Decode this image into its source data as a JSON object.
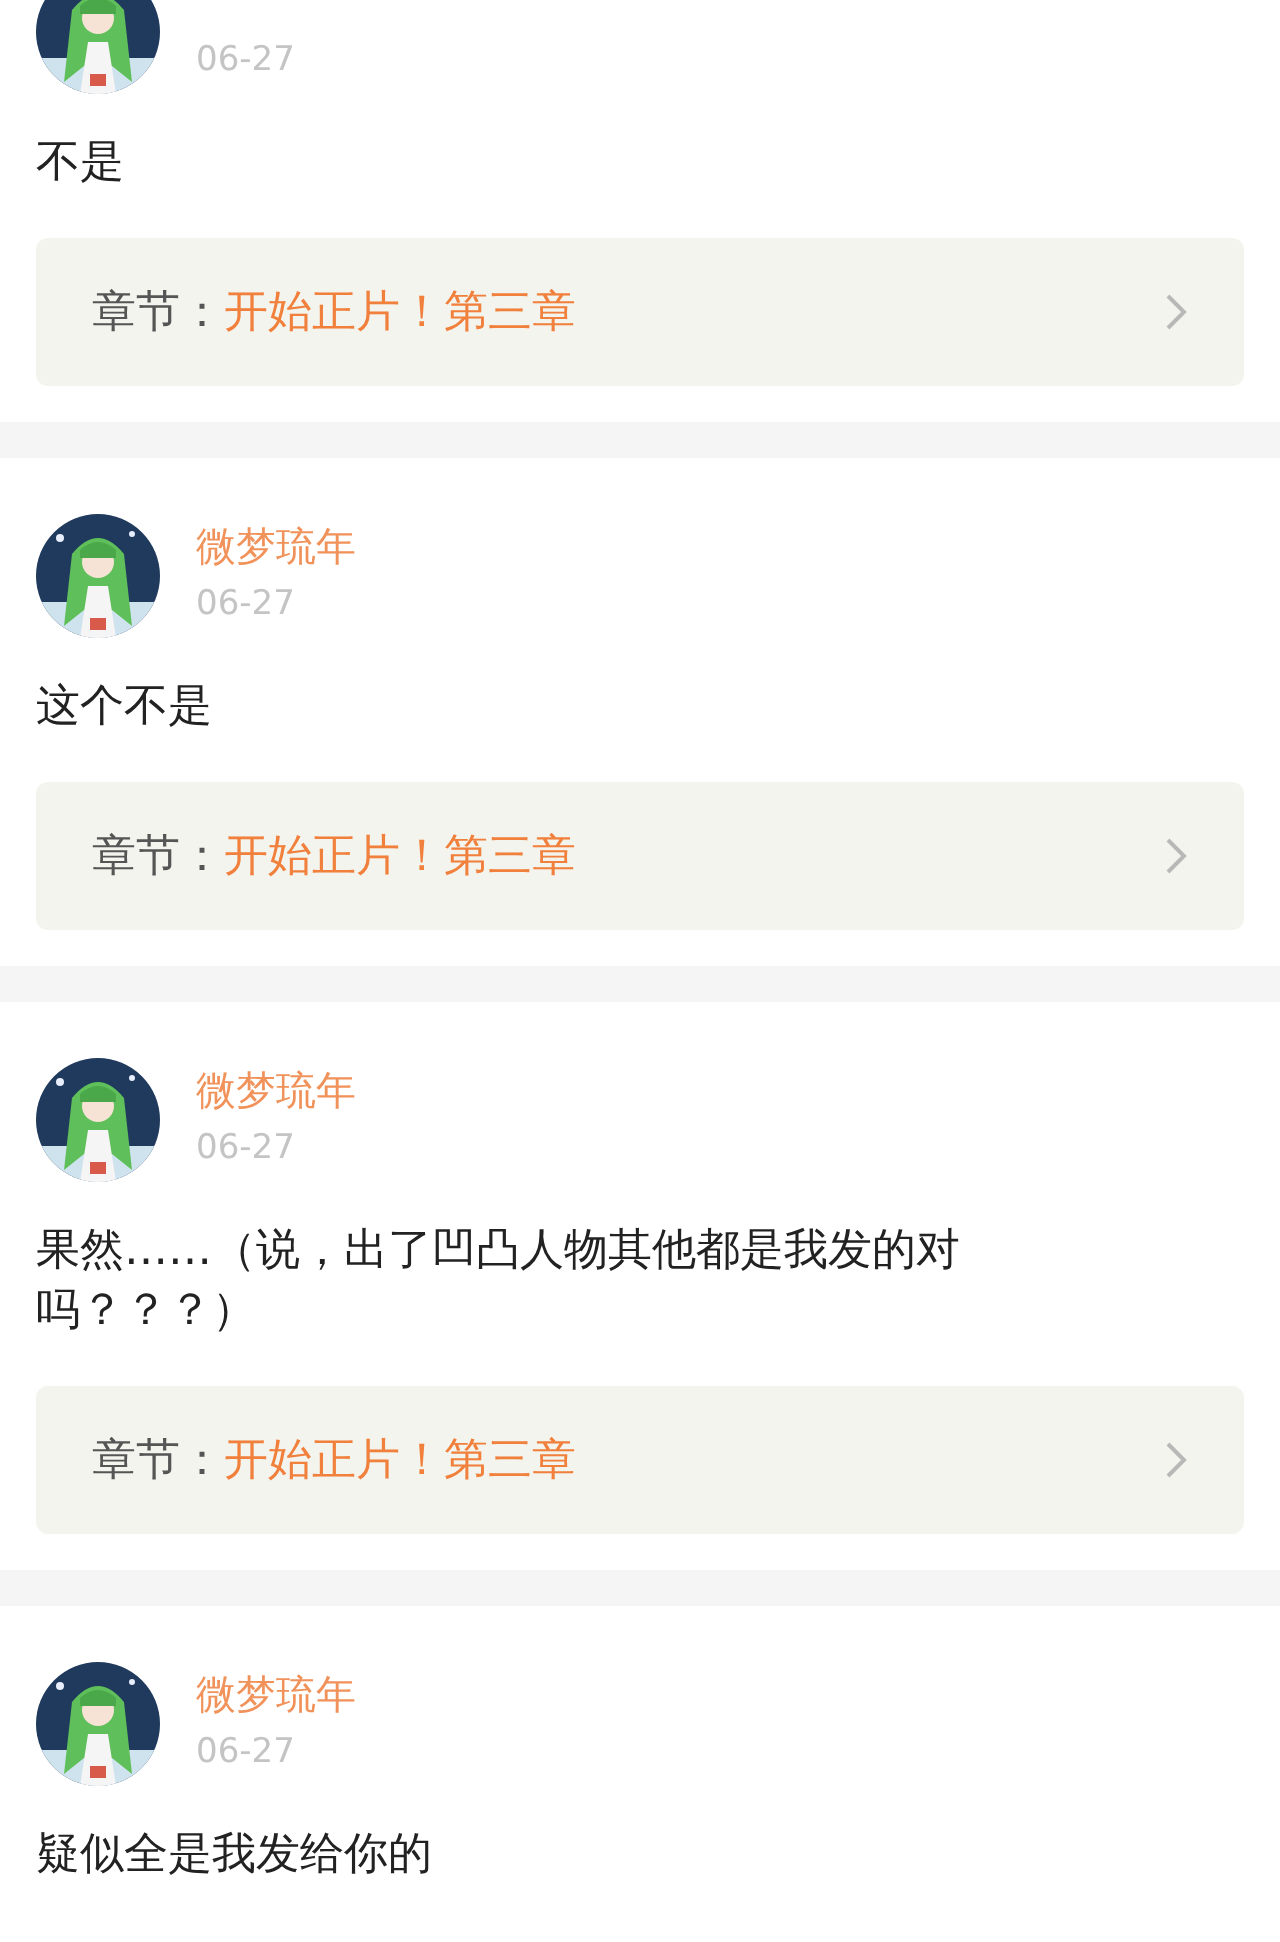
{
  "comments": [
    {
      "date": "06-27",
      "text": "不是",
      "chapter": {
        "label": "章节：",
        "title": "开始正片！第三章"
      }
    },
    {
      "author": "微梦琉年",
      "date": "06-27",
      "text": "这个不是",
      "chapter": {
        "label": "章节：",
        "title": "开始正片！第三章"
      }
    },
    {
      "author": "微梦琉年",
      "date": "06-27",
      "text": "果然……（说，出了凹凸人物其他都是我发的对吗？？？）",
      "chapter": {
        "label": "章节：",
        "title": "开始正片！第三章"
      }
    },
    {
      "author": "微梦琉年",
      "date": "06-27",
      "text": "疑似全是我发给你的"
    }
  ]
}
